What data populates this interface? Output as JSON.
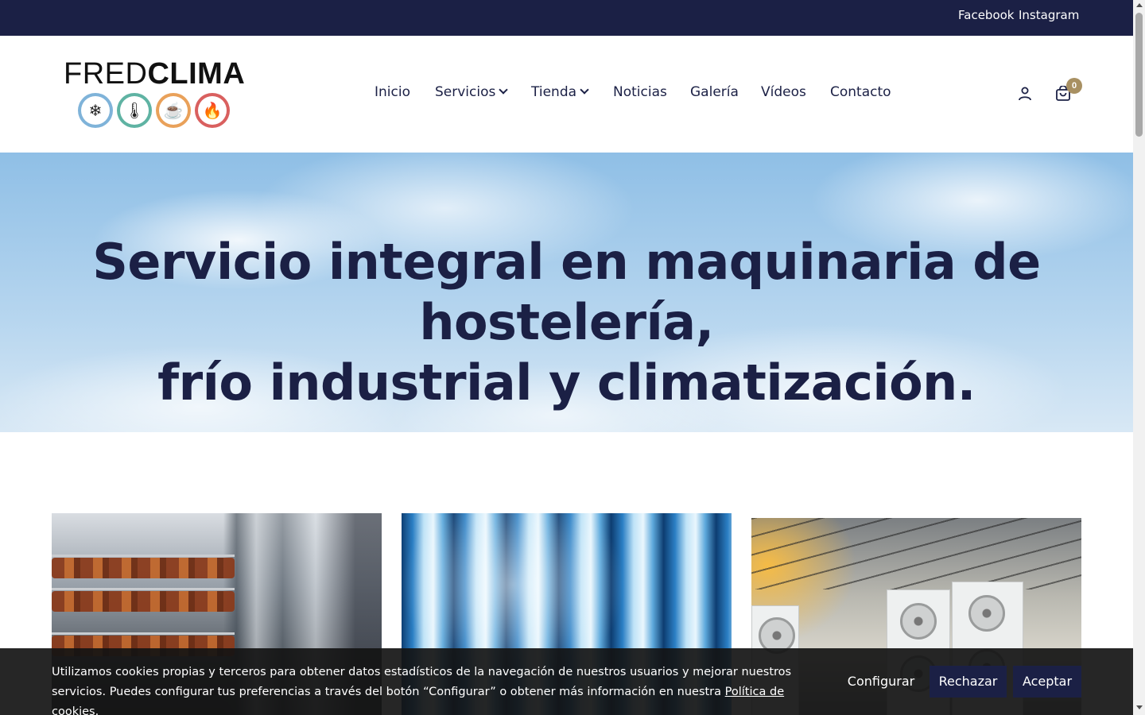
{
  "topbar": {
    "facebook": "Facebook",
    "instagram": "Instagram"
  },
  "logo": {
    "text_light": "FRED",
    "text_bold": "CLIMA",
    "icons": [
      "snowflake-icon",
      "thermometer-icon",
      "coffee-cup-icon",
      "flame-icon"
    ],
    "icon_glyphs": [
      "❄",
      "🌡",
      "☕",
      "🔥"
    ],
    "icon_colors": [
      "#7fb3d9",
      "#5fb3a3",
      "#e9a15a",
      "#d9605f"
    ]
  },
  "nav": {
    "items": [
      {
        "label": "Inicio",
        "has_dropdown": false
      },
      {
        "label": "Servicios",
        "has_dropdown": true
      },
      {
        "label": "Tienda",
        "has_dropdown": true
      },
      {
        "label": "Noticias",
        "has_dropdown": false
      },
      {
        "label": "Galería",
        "has_dropdown": false
      },
      {
        "label": "Vídeos",
        "has_dropdown": false
      },
      {
        "label": "Contacto",
        "has_dropdown": false
      }
    ]
  },
  "header": {
    "cart_count": "0",
    "account_icon": "user-icon",
    "cart_icon": "shopping-bag-icon"
  },
  "hero": {
    "line1": "Servicio integral en maquinaria de hostelería,",
    "line2": "frío industrial y climatización."
  },
  "cookie": {
    "text": "Utilizamos cookies propias y terceros para obtener datos estadísticos de la navegación de nuestros usuarios y mejorar nuestros servicios. Puedes configurar tus preferencias a través del botón “Configurar” o obtener más información en nuestra ",
    "link": "Política de cookies",
    "period": ".",
    "configure": "Configurar",
    "reject": "Rechazar",
    "accept": "Aceptar"
  },
  "colors": {
    "brand_navy": "#1b2045",
    "badge_gold": "#a89062"
  }
}
